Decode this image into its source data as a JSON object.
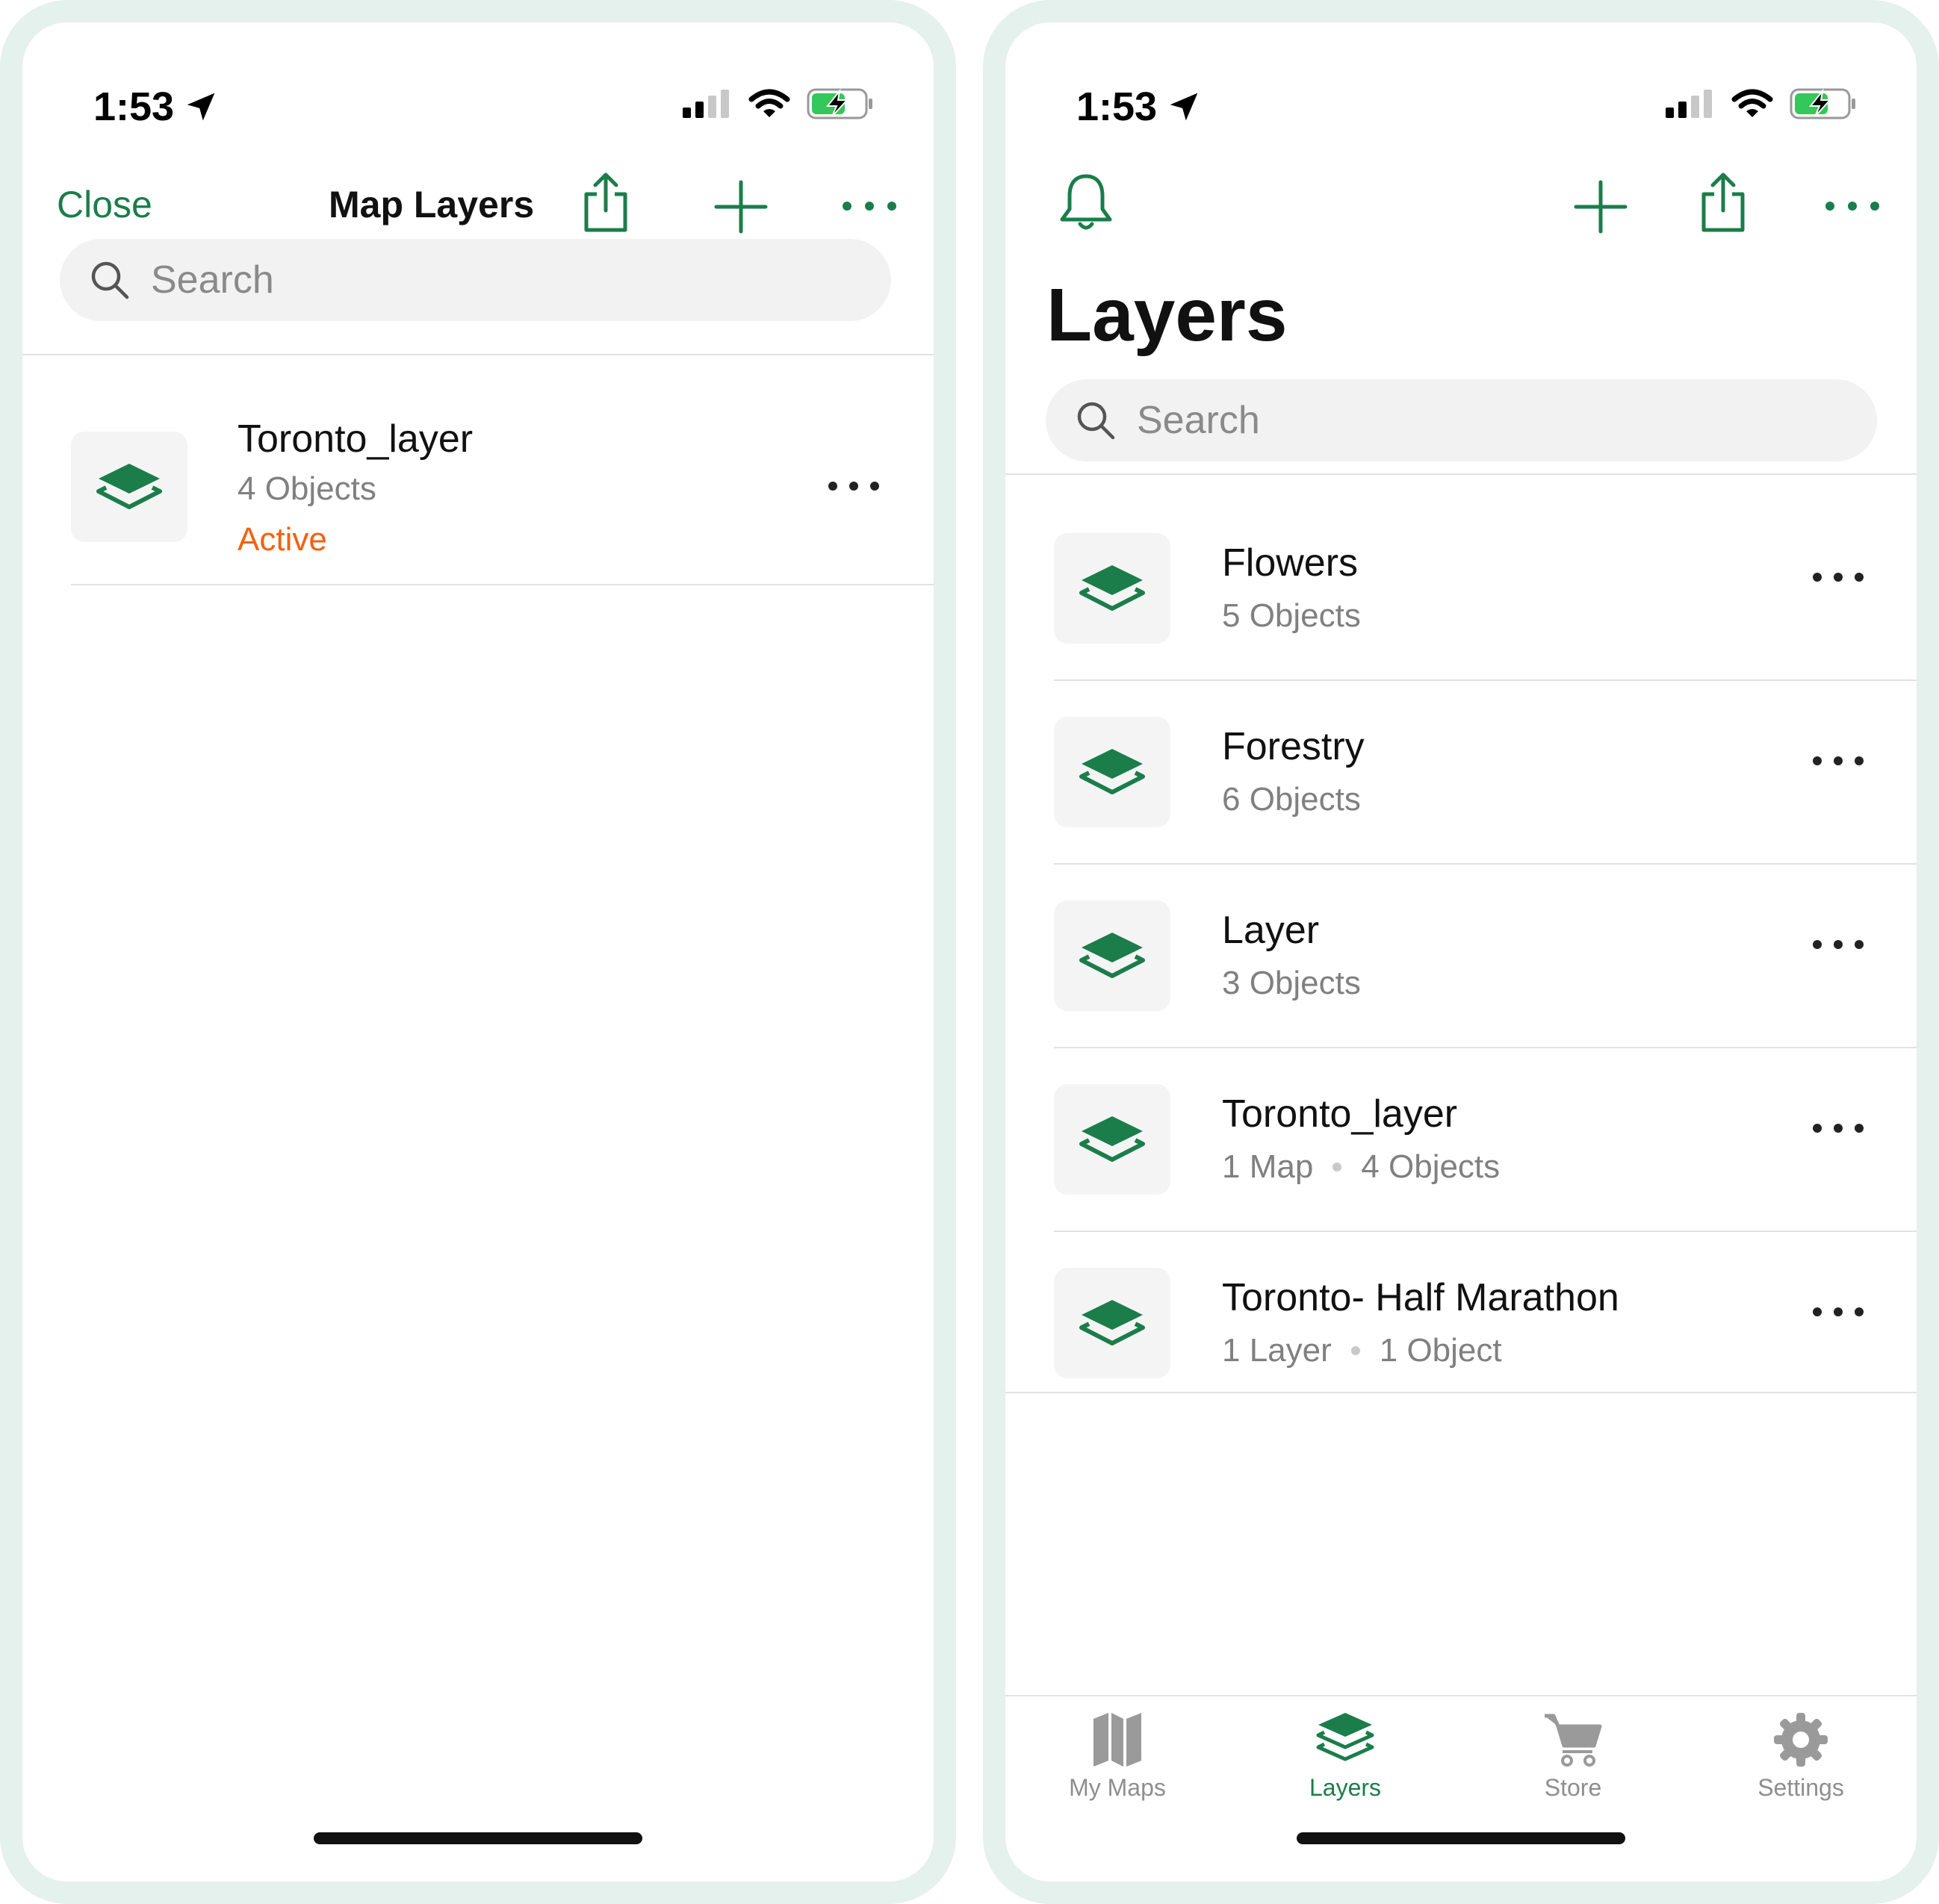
{
  "colors": {
    "accent": "#1b7d4a",
    "active_status": "#f2620f",
    "muted_text": "#808080"
  },
  "left_screen": {
    "status": {
      "time": "1:53"
    },
    "nav": {
      "close_label": "Close",
      "title": "Map Layers"
    },
    "search": {
      "placeholder": "Search"
    },
    "layers": [
      {
        "name": "Toronto_layer",
        "objects": "4 Objects",
        "status": "Active"
      }
    ]
  },
  "right_screen": {
    "status": {
      "time": "1:53"
    },
    "title": "Layers",
    "search": {
      "placeholder": "Search"
    },
    "layers": [
      {
        "name": "Flowers",
        "meta": [
          "5 Objects"
        ]
      },
      {
        "name": "Forestry",
        "meta": [
          "6 Objects"
        ]
      },
      {
        "name": "Layer",
        "meta": [
          "3 Objects"
        ]
      },
      {
        "name": "Toronto_layer",
        "meta": [
          "1 Map",
          "4 Objects"
        ]
      },
      {
        "name": "Toronto- Half Marathon",
        "meta": [
          "1 Layer",
          "1 Object"
        ]
      }
    ],
    "tabs": [
      {
        "label": "My Maps",
        "icon": "map-icon",
        "active": false
      },
      {
        "label": "Layers",
        "icon": "layers-icon",
        "active": true
      },
      {
        "label": "Store",
        "icon": "cart-icon",
        "active": false
      },
      {
        "label": "Settings",
        "icon": "gear-icon",
        "active": false
      }
    ]
  }
}
